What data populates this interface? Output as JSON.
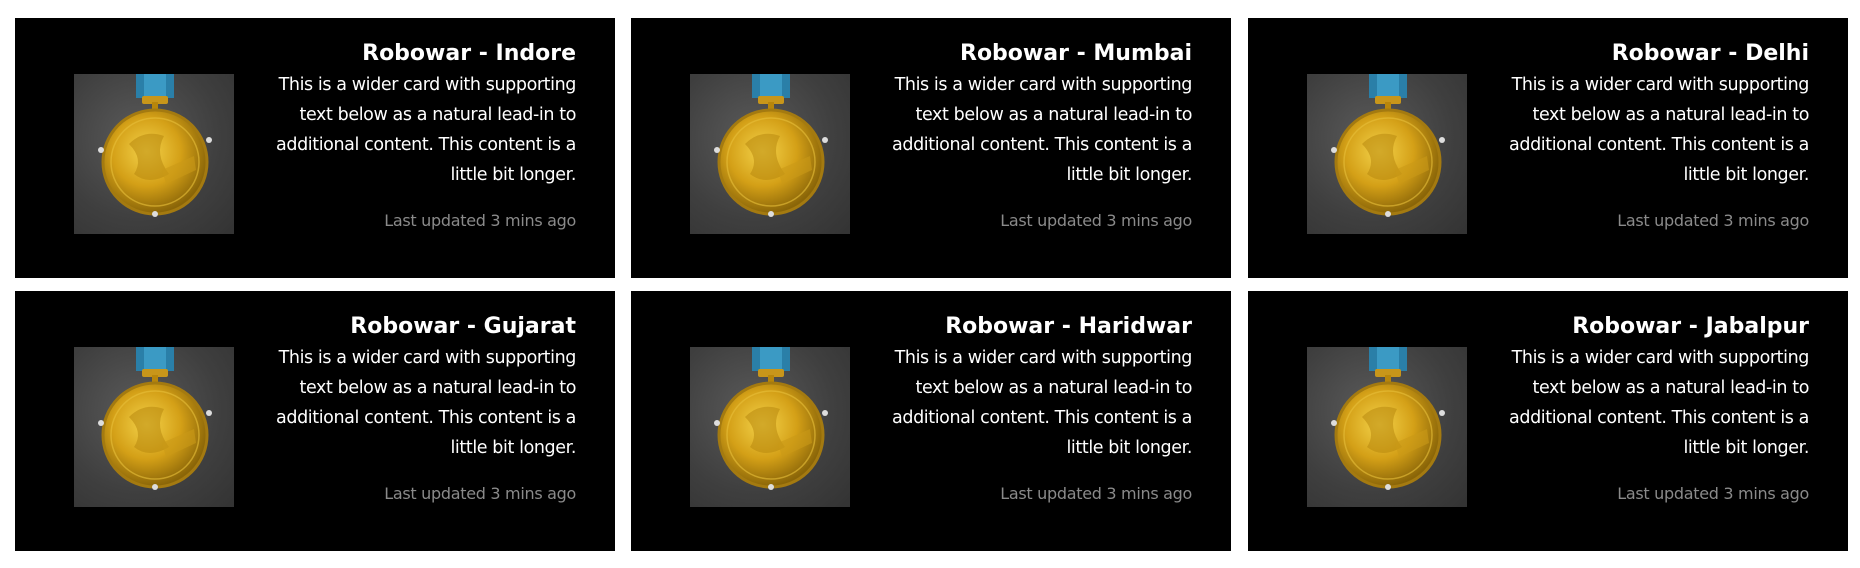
{
  "cards": [
    {
      "title": "Robowar - Indore",
      "text": "This is a wider card with supporting text below as a natural lead-in to additional content. This content is a little bit longer.",
      "updated": "Last updated 3 mins ago",
      "image_icon": "gold-medal-icon"
    },
    {
      "title": "Robowar - Mumbai",
      "text": "This is a wider card with supporting text below as a natural lead-in to additional content. This content is a little bit longer.",
      "updated": "Last updated 3 mins ago",
      "image_icon": "gold-medal-icon"
    },
    {
      "title": "Robowar - Delhi",
      "text": "This is a wider card with supporting text below as a natural lead-in to additional content. This content is a little bit longer.",
      "updated": "Last updated 3 mins ago",
      "image_icon": "gold-medal-icon"
    },
    {
      "title": "Robowar - Gujarat",
      "text": "This is a wider card with supporting text below as a natural lead-in to additional content. This content is a little bit longer.",
      "updated": "Last updated 3 mins ago",
      "image_icon": "gold-medal-icon"
    },
    {
      "title": "Robowar - Haridwar",
      "text": "This is a wider card with supporting text below as a natural lead-in to additional content. This content is a little bit longer.",
      "updated": "Last updated 3 mins ago",
      "image_icon": "gold-medal-icon"
    },
    {
      "title": "Robowar - Jabalpur",
      "text": "This is a wider card with supporting text below as a natural lead-in to additional content. This content is a little bit longer.",
      "updated": "Last updated 3 mins ago",
      "image_icon": "gold-medal-icon"
    }
  ],
  "colors": {
    "card_background": "#000000",
    "page_background": "#ffffff",
    "title_text": "#ffffff",
    "muted_text": "#8a8a8a",
    "medal_gold": "#d4a017",
    "ribbon_blue": "#2a7fa8"
  }
}
